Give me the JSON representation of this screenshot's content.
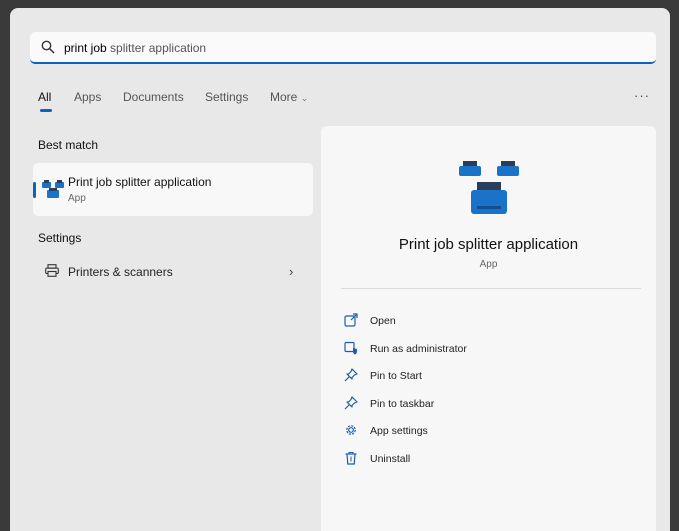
{
  "search": {
    "query_bold": "print job",
    "query_rest": " splitter application"
  },
  "filters": {
    "all": "All",
    "apps": "Apps",
    "documents": "Documents",
    "settings": "Settings",
    "more": "More",
    "more_dots": "···"
  },
  "best_match": {
    "section_label": "Best match",
    "title_bold": "Print job",
    "title_rest": " splitter application",
    "subtitle": "App"
  },
  "settings_section": {
    "section_label": "Settings",
    "item_label": "Printers & scanners"
  },
  "details": {
    "title": "Print job splitter application",
    "subtitle": "App",
    "actions": [
      {
        "label": "Open",
        "icon": "open-icon"
      },
      {
        "label": "Run as administrator",
        "icon": "shield-icon"
      },
      {
        "label": "Pin to Start",
        "icon": "pin-icon"
      },
      {
        "label": "Pin to taskbar",
        "icon": "pin-icon"
      },
      {
        "label": "App settings",
        "icon": "gear-icon"
      },
      {
        "label": "Uninstall",
        "icon": "trash-icon"
      }
    ]
  },
  "colors": {
    "accent": "#1060c0",
    "printer_blue": "#1a73c9"
  }
}
